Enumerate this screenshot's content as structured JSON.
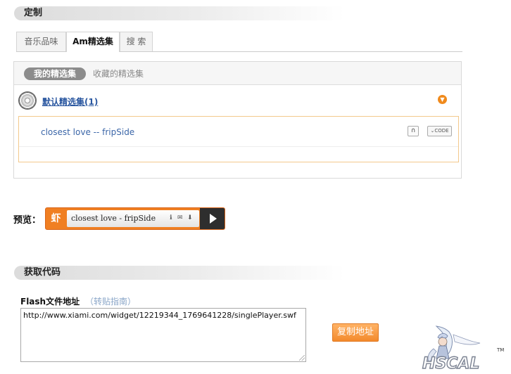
{
  "customize": {
    "title": "定制"
  },
  "tabs": [
    {
      "label": "音乐品味",
      "active": false
    },
    {
      "label": "Am精选集",
      "active": true
    },
    {
      "label": "搜 索",
      "active": false
    }
  ],
  "collections": {
    "my_tab": "我的精选集",
    "fav_tab": "收藏的精选集",
    "default_title": "默认精选集(1)",
    "songs": [
      {
        "name": "closest love -- fripSide"
      }
    ],
    "code_label": "CODE"
  },
  "preview": {
    "label": "预览：",
    "logo": "虾",
    "title": "closest love - fripSide"
  },
  "get_code": {
    "title": "获取代码",
    "flash_label": "Flash文件地址",
    "guide": "（转贴指南）",
    "url": "http://www.xiami.com/widget/12219344_1769641228/singlePlayer.swf",
    "copy_button": "复制地址"
  },
  "watermark": {
    "text": "HSCAL",
    "tm": "TM"
  },
  "colors": {
    "accent": "#f07f22",
    "link": "#3b66a8",
    "box_border": "#f3c98c"
  }
}
